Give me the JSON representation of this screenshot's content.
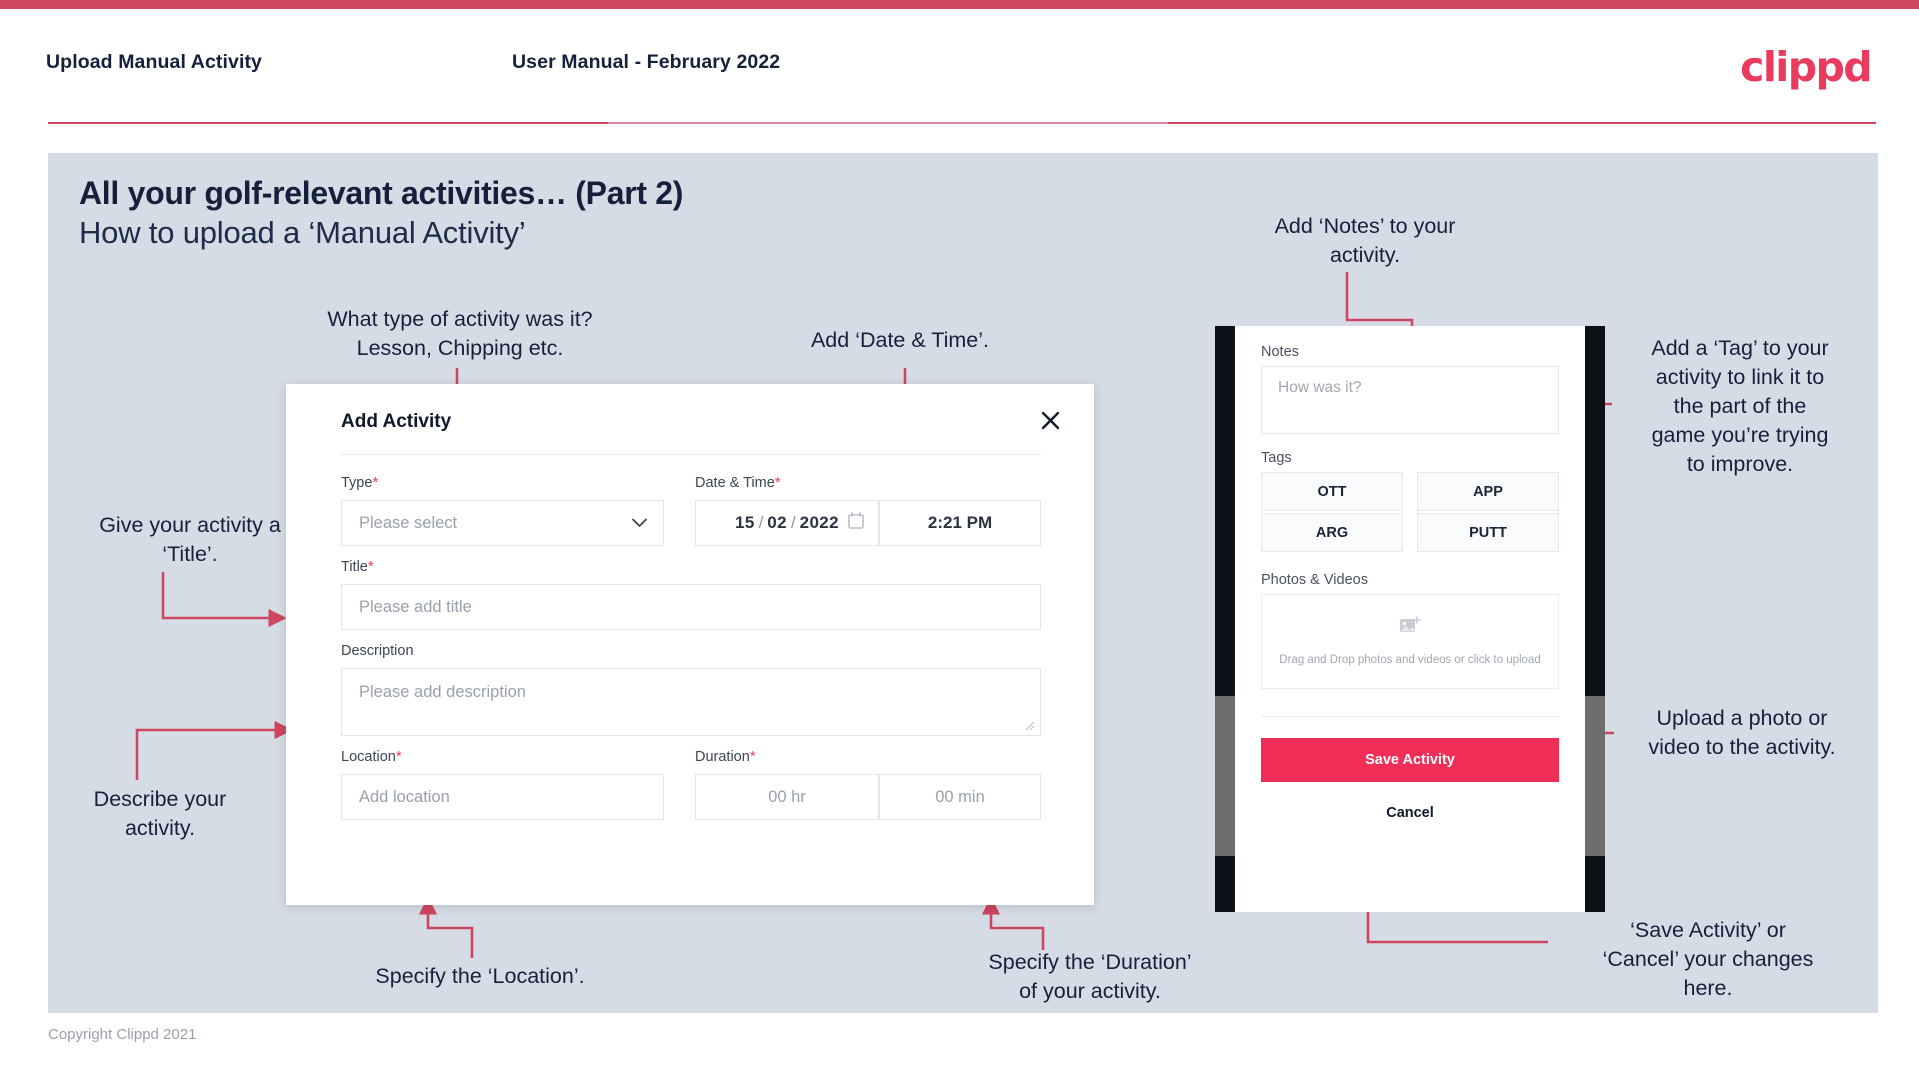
{
  "header": {
    "left_title": "Upload Manual Activity",
    "center_title": "User Manual - February 2022",
    "logo_text": "clippd"
  },
  "slide": {
    "title_main": "All your golf-relevant activities… (Part 2)",
    "title_sub": "How to upload a ‘Manual Activity’"
  },
  "annotations": {
    "type": "What type of activity was it?\nLesson, Chipping etc.",
    "datetime": "Add ‘Date & Time’.",
    "title": "Give your activity a\n‘Title’.",
    "description": "Describe your\nactivity.",
    "location": "Specify the ‘Location’.",
    "duration": "Specify the ‘Duration’\nof your activity.",
    "notes": "Add ‘Notes’ to your\nactivity.",
    "tags": "Add a ‘Tag’ to your\nactivity to link it to\nthe part of the\ngame you’re trying\nto improve.",
    "photos": "Upload a photo or\nvideo to the activity.",
    "save_cancel": "‘Save Activity’ or\n‘Cancel’ your changes\nhere."
  },
  "dialog": {
    "title": "Add Activity",
    "close_icon": "close-icon",
    "fields": {
      "type": {
        "label": "Type",
        "required": "*",
        "placeholder": "Please select",
        "chevron_icon": "chevron-down-icon"
      },
      "datetime": {
        "label": "Date & Time",
        "required": "*",
        "day": "15",
        "month": "02",
        "year": "2022",
        "sep": "/",
        "calendar_icon": "calendar-icon",
        "time": "2:21 PM"
      },
      "title": {
        "label": "Title",
        "required": "*",
        "placeholder": "Please add title"
      },
      "description": {
        "label": "Description",
        "required": "",
        "placeholder": "Please add description"
      },
      "location": {
        "label": "Location",
        "required": "*",
        "placeholder": "Add location"
      },
      "duration": {
        "label": "Duration",
        "required": "*",
        "hours_placeholder": "00 hr",
        "minutes_placeholder": "00 min"
      }
    }
  },
  "phone": {
    "notes": {
      "label": "Notes",
      "placeholder": "How was it?"
    },
    "tags": {
      "label": "Tags",
      "items": [
        "OTT",
        "APP",
        "ARG",
        "PUTT"
      ]
    },
    "photos": {
      "label": "Photos & Videos",
      "icon": "add-photo-icon",
      "dropzone_text": "Drag and Drop photos and videos or click to upload"
    },
    "save_label": "Save Activity",
    "cancel_label": "Cancel"
  },
  "footer": {
    "copyright": "Copyright Clippd 2021"
  },
  "colors": {
    "brand_crimson": "#ea3a5e",
    "top_bar": "#cf4661",
    "slide_bg": "#d6dce5",
    "arrow": "#cf4661",
    "save_button": "#ef2d56",
    "text_dark": "#15213c",
    "required_star": "#ef4056"
  }
}
